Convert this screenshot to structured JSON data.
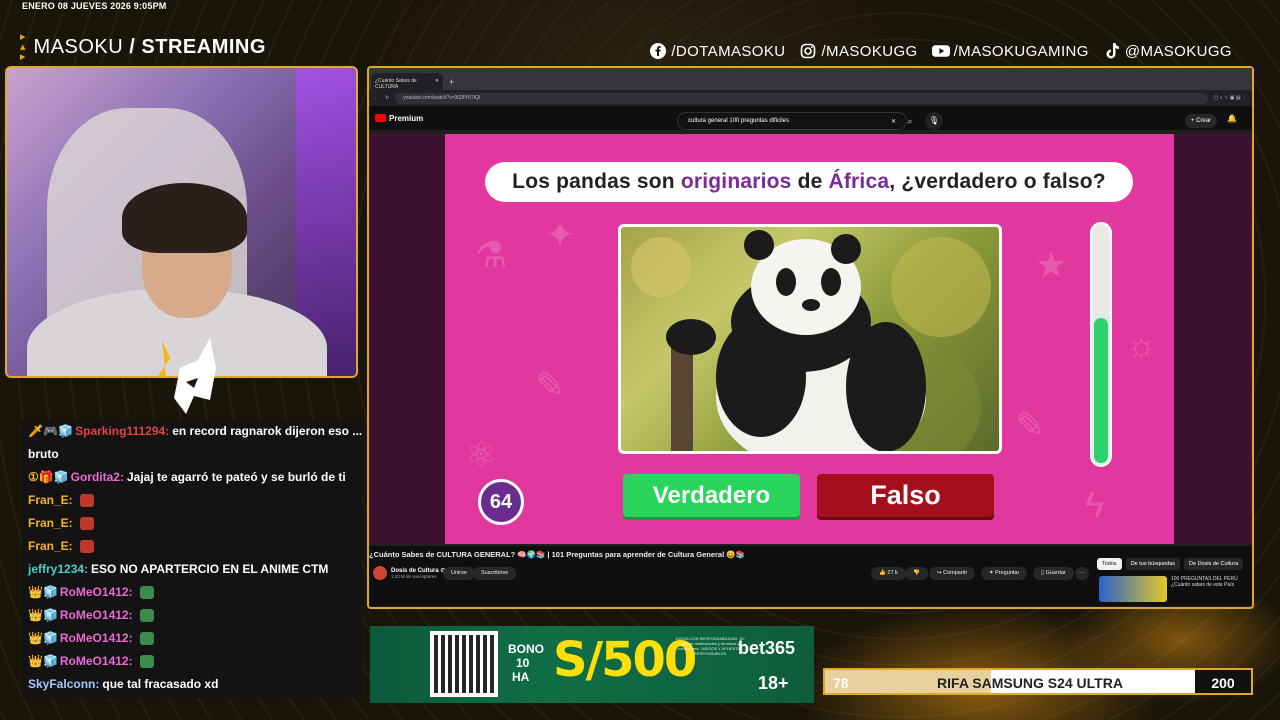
{
  "date": "ENERO 08 JUEVES 2026 9:05PM",
  "brand": {
    "name": "MASOKU",
    "separator": "/",
    "tag": "STREAMING"
  },
  "socials": [
    {
      "icon": "facebook-icon",
      "handle": "/DOTAMASOKU"
    },
    {
      "icon": "instagram-icon",
      "handle": "/MASOKUGG"
    },
    {
      "icon": "youtube-icon",
      "handle": "/MASOKUGAMING"
    },
    {
      "icon": "tiktok-icon",
      "handle": "@MASOKUGG"
    }
  ],
  "chat": [
    {
      "badges": "🗡🎮🧊",
      "user": "Sparking111294:",
      "user_color": "#e0434b",
      "message": "en record ragnarok dijeron eso ...",
      "emote": ""
    },
    {
      "badges": "",
      "user": "",
      "user_color": "#ffffff",
      "message": "bruto",
      "emote": ""
    },
    {
      "badges": "①🎁🧊",
      "user": "Gordita2:",
      "user_color": "#e96bd4",
      "message": "Jajaj te agarró te pateó y se burló de ti",
      "emote": ""
    },
    {
      "badges": "",
      "user": "Fran_E:",
      "user_color": "#f3b617",
      "message": "",
      "emote": "#c0392b"
    },
    {
      "badges": "",
      "user": "Fran_E:",
      "user_color": "#f3b617",
      "message": "",
      "emote": "#c0392b"
    },
    {
      "badges": "",
      "user": "Fran_E:",
      "user_color": "#f3b617",
      "message": "",
      "emote": "#c0392b"
    },
    {
      "badges": "",
      "user": "jeffry1234:",
      "user_color": "#49d0c5",
      "message": "ESO NO APARTERCIO EN EL ANIME CTM",
      "emote": ""
    },
    {
      "badges": "👑🧊",
      "user": "RoMeO1412:",
      "user_color": "#e96bd4",
      "message": "",
      "emote": "#3c8a4c"
    },
    {
      "badges": "👑🧊",
      "user": "RoMeO1412:",
      "user_color": "#e96bd4",
      "message": "",
      "emote": "#3c8a4c"
    },
    {
      "badges": "👑🧊",
      "user": "RoMeO1412:",
      "user_color": "#e96bd4",
      "message": "",
      "emote": "#3c8a4c"
    },
    {
      "badges": "👑🧊",
      "user": "RoMeO1412:",
      "user_color": "#e96bd4",
      "message": "",
      "emote": "#3c8a4c"
    },
    {
      "badges": "",
      "user": "SkyFalconn:",
      "user_color": "#a7c7ff",
      "message": "que tal fracasado xd",
      "emote": ""
    }
  ],
  "browser": {
    "tab_title": "¿Cuánto Sabes de CULTURA",
    "url": "youtube.com/watch?v=3tZ8Y6TtQI",
    "premium_label": "Premium",
    "search_query": "cultura general 100 preguntas dificiles",
    "create_label": "+ Crear"
  },
  "quiz": {
    "question_pre": "Los pandas son",
    "highlight1": "originarios",
    "question_mid": "de",
    "highlight2": "África",
    "question_post": ", ¿verdadero o falso?",
    "true_label": "Verdadero",
    "false_label": "Falso",
    "question_number": "64",
    "timer_fraction": 0.6
  },
  "video_meta": {
    "title": "¿Cuánto Sabes de CULTURA GENERAL? 🧠🌍📚 | 101 Preguntas para aprender de Cultura General 😄📚",
    "channel": "Dosis de Cultura ⊙",
    "subs": "1.33 M de suscriptores",
    "join": "Unirse",
    "subscribed": "Suscribirse",
    "likes": "27 k",
    "share": "Compartir",
    "ask": "Preguntar",
    "save": "Guardar",
    "more": "···",
    "chips": [
      "Todos",
      "De tus búsquedas",
      "De Dosis de Cultura"
    ],
    "rec_title": "100 PREGUNTAS DEL PERÚ ¿Cuánto sabes de este País"
  },
  "ad": {
    "bono": "BONO",
    "line2": "10",
    "line3": "HA",
    "amount": "S/500",
    "fine_print": "JUEGA CON RESPONSABILIDAD. Se aplican restricciones y términos y condiciones. JUEGOS Y APUESTAS RESPONSABLES",
    "brand": "bet365",
    "age": "18+"
  },
  "rifa": {
    "current": "78",
    "title": "RIFA SAMSUNG S24 ULTRA",
    "goal": "200",
    "progress": 0.39
  }
}
